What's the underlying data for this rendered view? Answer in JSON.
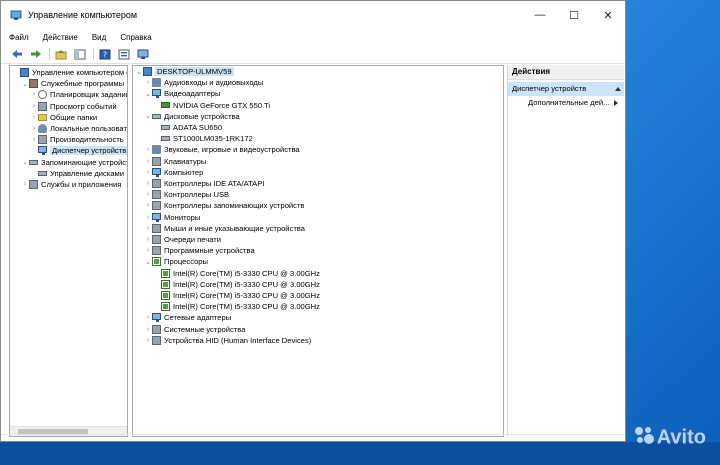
{
  "window": {
    "title": "Управление компьютером",
    "controls": [
      "—",
      "☐",
      "✕"
    ]
  },
  "menu": [
    "Файл",
    "Действие",
    "Вид",
    "Справка"
  ],
  "left_tree": [
    {
      "label": "Управление компьютером (л",
      "level": 0,
      "arrow": "",
      "icon": "pc"
    },
    {
      "label": "Служебные программы",
      "level": 1,
      "arrow": "⌄",
      "icon": "tools"
    },
    {
      "label": "Планировщик заданий",
      "level": 2,
      "arrow": "›",
      "icon": "clock"
    },
    {
      "label": "Просмотр событий",
      "level": 2,
      "arrow": "›",
      "icon": "gen"
    },
    {
      "label": "Общие папки",
      "level": 2,
      "arrow": "›",
      "icon": "folder"
    },
    {
      "label": "Локальные пользовате",
      "level": 2,
      "arrow": "›",
      "icon": "users"
    },
    {
      "label": "Производительность",
      "level": 2,
      "arrow": "›",
      "icon": "gen"
    },
    {
      "label": "Диспетчер устройств",
      "level": 2,
      "arrow": "",
      "icon": "monitor",
      "selected": true
    },
    {
      "label": "Запоминающие устройст",
      "level": 1,
      "arrow": "⌄",
      "icon": "disk"
    },
    {
      "label": "Управление дисками",
      "level": 2,
      "arrow": "",
      "icon": "disk"
    },
    {
      "label": "Службы и приложения",
      "level": 1,
      "arrow": "›",
      "icon": "gen"
    }
  ],
  "device_tree": [
    {
      "label": "DESKTOP-ULMMV59",
      "level": 0,
      "arrow": "⌄",
      "icon": "pc",
      "selected": true
    },
    {
      "label": "Аудиовходы и аудиовыходы",
      "level": 1,
      "arrow": "›",
      "icon": "speaker"
    },
    {
      "label": "Видеоадаптеры",
      "level": 1,
      "arrow": "⌄",
      "icon": "monitor"
    },
    {
      "label": "NVIDIA GeForce GTX 550 Ti",
      "level": 2,
      "arrow": "",
      "icon": "card"
    },
    {
      "label": "Дисковые устройства",
      "level": 1,
      "arrow": "⌄",
      "icon": "disk"
    },
    {
      "label": "ADATA SU650",
      "level": 2,
      "arrow": "",
      "icon": "disk"
    },
    {
      "label": "ST1000LM035-1RK172",
      "level": 2,
      "arrow": "",
      "icon": "disk"
    },
    {
      "label": "Звуковые, игровые и видеоустройства",
      "level": 1,
      "arrow": "›",
      "icon": "speaker"
    },
    {
      "label": "Клавиатуры",
      "level": 1,
      "arrow": "›",
      "icon": "gen"
    },
    {
      "label": "Компьютер",
      "level": 1,
      "arrow": "›",
      "icon": "monitor"
    },
    {
      "label": "Контроллеры IDE ATA/ATAPI",
      "level": 1,
      "arrow": "›",
      "icon": "gen"
    },
    {
      "label": "Контроллеры USB",
      "level": 1,
      "arrow": "›",
      "icon": "gen"
    },
    {
      "label": "Контроллеры запоминающих устройств",
      "level": 1,
      "arrow": "›",
      "icon": "gen"
    },
    {
      "label": "Мониторы",
      "level": 1,
      "arrow": "›",
      "icon": "monitor"
    },
    {
      "label": "Мыши и иные указывающие устройства",
      "level": 1,
      "arrow": "›",
      "icon": "gen"
    },
    {
      "label": "Очереди печати",
      "level": 1,
      "arrow": "›",
      "icon": "gen"
    },
    {
      "label": "Программные устройства",
      "level": 1,
      "arrow": "›",
      "icon": "gen"
    },
    {
      "label": "Процессоры",
      "level": 1,
      "arrow": "⌄",
      "icon": "cpu"
    },
    {
      "label": "Intel(R) Core(TM) i5-3330 CPU @ 3.00GHz",
      "level": 2,
      "arrow": "",
      "icon": "cpu"
    },
    {
      "label": "Intel(R) Core(TM) i5-3330 CPU @ 3.00GHz",
      "level": 2,
      "arrow": "",
      "icon": "cpu"
    },
    {
      "label": "Intel(R) Core(TM) i5-3330 CPU @ 3.00GHz",
      "level": 2,
      "arrow": "",
      "icon": "cpu"
    },
    {
      "label": "Intel(R) Core(TM) i5-3330 CPU @ 3.00GHz",
      "level": 2,
      "arrow": "",
      "icon": "cpu"
    },
    {
      "label": "Сетевые адаптеры",
      "level": 1,
      "arrow": "›",
      "icon": "monitor"
    },
    {
      "label": "Системные устройства",
      "level": 1,
      "arrow": "›",
      "icon": "gen"
    },
    {
      "label": "Устройства HID (Human Interface Devices)",
      "level": 1,
      "arrow": "›",
      "icon": "gen"
    }
  ],
  "actions": {
    "header": "Действия",
    "section": "Диспетчер устройств",
    "item": "Дополнительные дей..."
  },
  "watermark": "Avito"
}
